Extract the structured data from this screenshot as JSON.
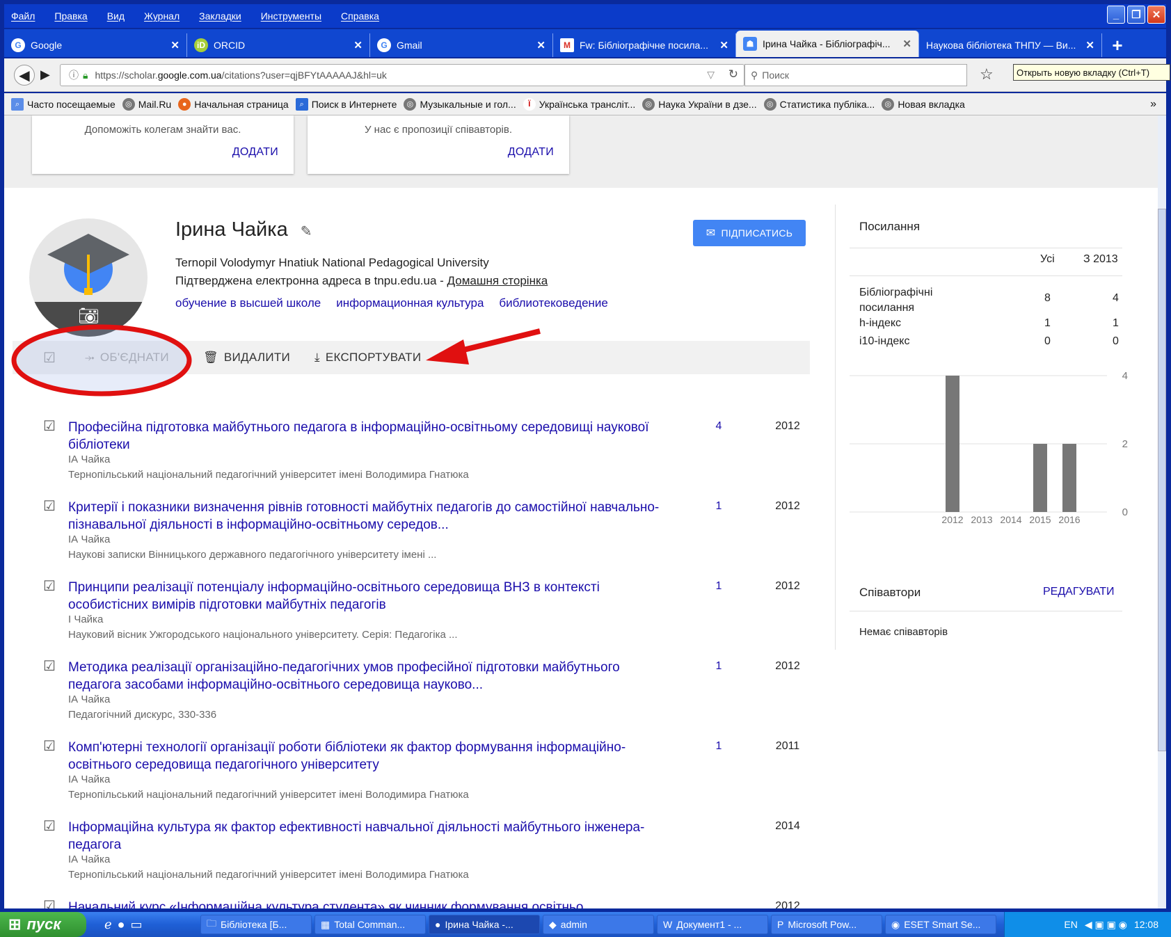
{
  "menubar": [
    "Файл",
    "Правка",
    "Вид",
    "Журнал",
    "Закладки",
    "Инструменты",
    "Справка"
  ],
  "tabs": [
    {
      "label": "Google",
      "icon": "google-icon",
      "color": "#4285f4"
    },
    {
      "label": "ORCID",
      "icon": "orcid-icon",
      "color": "#a6ce39"
    },
    {
      "label": "Gmail",
      "icon": "google-icon",
      "color": "#4285f4"
    },
    {
      "label": "Fw: Бібліографічне посила...",
      "icon": "gmail-icon",
      "color": "#d93025"
    },
    {
      "label": "Ірина Чайка - Бібліографіч...",
      "icon": "scholar-icon",
      "color": "#4285f4",
      "active": true
    },
    {
      "label": "Наукова бібліотека ТНПУ — Ви...",
      "icon": "",
      "color": "#1047d0"
    }
  ],
  "nav": {
    "url_prefix": "https://scholar.",
    "url_domain": "google.com.ua",
    "url_suffix": "/citations?user=qjBFYtAAAAAJ&hl=uk",
    "search_placeholder": "Поиск",
    "tooltip": "Открыть новую вкладку (Ctrl+T)"
  },
  "bookmarks": [
    "Часто посещаемые",
    "Mail.Ru",
    "Начальная страница",
    "Поиск в Интернете",
    "Музыкальные и гол...",
    "Українська трансліт...",
    "Наука України в дзе...",
    "Статистика публіка...",
    "Новая вкладка"
  ],
  "cards": [
    {
      "text": "Допоможіть колегам знайти вас.",
      "button": "ДОДАТИ"
    },
    {
      "text": "У нас є пропозиції співавторів.",
      "button": "ДОДАТИ"
    }
  ],
  "profile": {
    "name": "Ірина Чайка",
    "affiliation": "Ternopil Volodymyr Hnatiuk National Pedagogical University",
    "email_text": "Підтверджена електронна адреса в tnpu.edu.ua - ",
    "homepage": "Домашня сторінка",
    "interests": [
      "обучение в высшей школе",
      "информационная культура",
      "библиотековедение"
    ],
    "subscribe": "ПІДПИСАТИСЬ"
  },
  "toolbar": {
    "merge": "ОБ'ЄДНАТИ",
    "delete": "ВИДАЛИТИ",
    "export": "ЕКСПОРТУВАТИ"
  },
  "articles": [
    {
      "title": "Професійна підготовка майбутнього педагога в інформаційно-освітньому середовищі наукової бібліотеки",
      "authors": "ІА Чайка",
      "venue": "Тернопільський національний педагогічний університет імені Володимира Гнатюка",
      "cites": "4",
      "year": "2012"
    },
    {
      "title": "Критерії і показники визначення рівнів готовності майбутніх педагогів до самостійної навчально-пізнавальної діяльності в інформаційно-освітньому середов...",
      "authors": "ІА Чайка",
      "venue": "Наукові записки Вінницького державного педагогічного університету імені ...",
      "cites": "1",
      "year": "2012"
    },
    {
      "title": "Принципи реалізації потенціалу інформаційно-освітнього середовища ВНЗ в контексті особистісних вимірів підготовки майбутніх педагогів",
      "authors": "І Чайка",
      "venue": "Науковий вісник Ужгородського національного університету. Серія: Педагогіка ...",
      "cites": "1",
      "year": "2012"
    },
    {
      "title": "Методика реалізації організаційно-педагогічних умов професійної підготовки майбутнього педагога засобами інформаційно-освітнього середовища науково...",
      "authors": "ІА Чайка",
      "venue": "Педагогічний дискурс, 330-336",
      "cites": "1",
      "year": "2012"
    },
    {
      "title": "Комп'ютерні технології організації роботи бібліотеки як фактор формування інформаційно-освітнього середовища педагогічного університету",
      "authors": "ІА Чайка",
      "venue": "Тернопільський національний педагогічний університет імені Володимира Гнатюка",
      "cites": "1",
      "year": "2011"
    },
    {
      "title": "Інформаційна культура як фактор ефективності навчальної діяльності майбутнього інженера-педагога",
      "authors": "ІА Чайка",
      "venue": "Тернопільський національний педагогічний університет імені Володимира Гнатюка",
      "cites": "",
      "year": "2014"
    },
    {
      "title": "Начальний курс «Інформаційна культура студента» як чинник формування освітньо...",
      "authors": "",
      "venue": "",
      "cites": "",
      "year": "2012"
    }
  ],
  "citations": {
    "header": "Посилання",
    "col_all": "Усі",
    "col_since": "З 2013",
    "rows": [
      {
        "label": "Бібліографічні посилання",
        "all": "8",
        "since": "4"
      },
      {
        "label": "h-індекс",
        "all": "1",
        "since": "1"
      },
      {
        "label": "i10-індекс",
        "all": "0",
        "since": "0"
      }
    ]
  },
  "chart_data": {
    "type": "bar",
    "categories": [
      "2012",
      "2013",
      "2014",
      "2015",
      "2016"
    ],
    "values": [
      4,
      0,
      0,
      2,
      2
    ],
    "ylim": [
      0,
      4
    ],
    "yticks": [
      "4",
      "2",
      "0"
    ],
    "bar_color": "#777777"
  },
  "coauthors": {
    "header": "Співавтори",
    "edit": "РЕДАГУВАТИ",
    "none": "Немає співавторів"
  },
  "taskbar": {
    "start": "пуск",
    "tasks": [
      "Бібліотека [Б...",
      "Total Comman...",
      "Ірина Чайка -...",
      "admin",
      "Документ1 - ...",
      "Microsoft Pow...",
      "ESET Smart Se..."
    ],
    "lang": "EN",
    "clock": "12:08"
  }
}
